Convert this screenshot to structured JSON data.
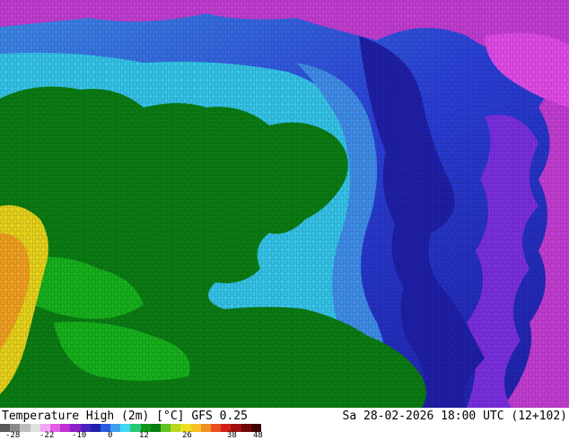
{
  "map": {
    "colors": {
      "cold_purple": "#c23dd2",
      "magenta": "#e04be8",
      "violet": "#7a2fe0",
      "deep_blue": "#1f1fa8",
      "blue": "#2a3fd8",
      "light_blue": "#3f8de8",
      "cyan": "#35c4e8",
      "land_green": "#0b7c14",
      "bright_green": "#17b01c",
      "yellow": "#e6d21a",
      "orange": "#f0a020"
    }
  },
  "footer": {
    "title": "Temperature High (2m) [°C] GFS 0.25",
    "datetime": "Sa 28-02-2026 18:00 UTC (12+102)"
  },
  "colorbar": {
    "ticks": [
      "-28",
      "-22",
      "-10",
      "0",
      "12",
      "26",
      "38",
      "48"
    ],
    "colors": [
      "#5a5a5a",
      "#8a8a8a",
      "#bdbdbd",
      "#e0e0e0",
      "#f4a6f4",
      "#e060e8",
      "#c030d0",
      "#8a20c8",
      "#4a20c0",
      "#2020a8",
      "#2a5ae0",
      "#3fa0f0",
      "#40d8f0",
      "#28c878",
      "#109818",
      "#0b7c14",
      "#60c020",
      "#b8d820",
      "#f0e020",
      "#f8c020",
      "#f09020",
      "#e85020",
      "#d02018",
      "#a01010",
      "#700808",
      "#400404"
    ]
  }
}
